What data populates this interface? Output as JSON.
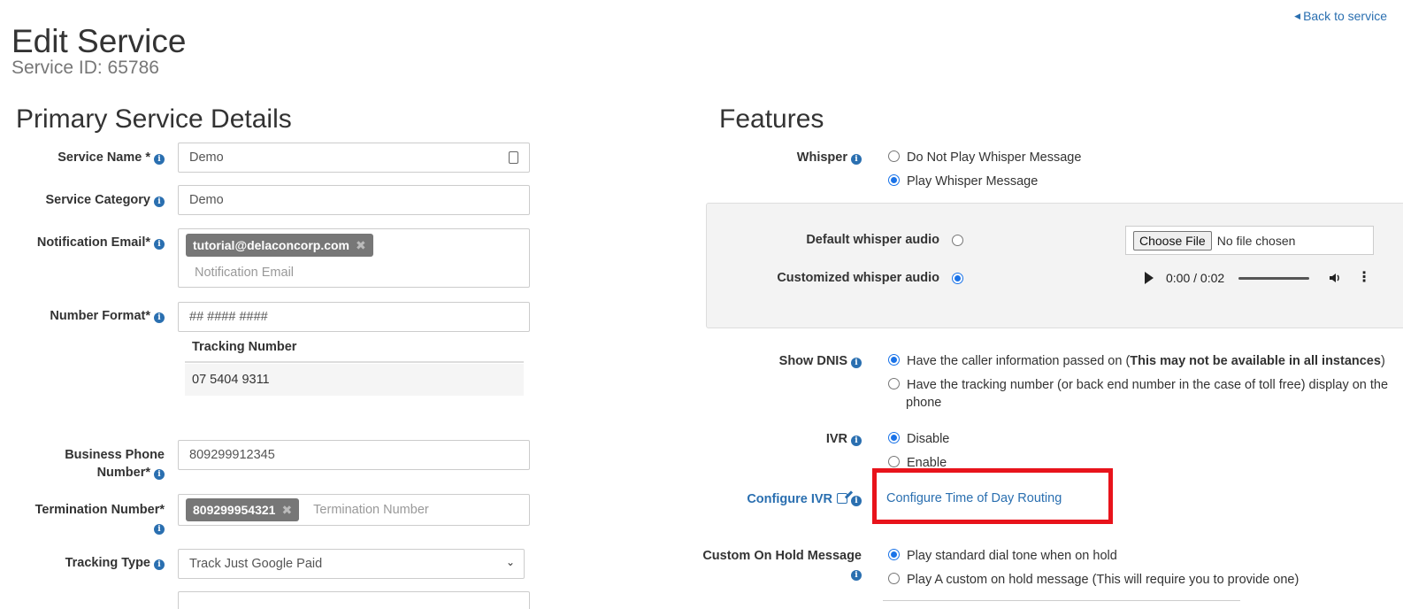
{
  "header": {
    "back_link": "Back to service",
    "title": "Edit Service",
    "subtitle": "Service ID: 65786"
  },
  "primary": {
    "section_title": "Primary Service Details",
    "service_name": {
      "label": "Service Name *",
      "value": "Demo"
    },
    "service_category": {
      "label": "Service Category",
      "value": "Demo"
    },
    "notification_email": {
      "label": "Notification Email*",
      "tag": "tutorial@delaconcorp.com",
      "placeholder": "Notification Email"
    },
    "number_format": {
      "label": "Number Format*",
      "value": "## #### ####"
    },
    "tracking_table": {
      "header": "Tracking Number",
      "rows": [
        "07 5404 9311"
      ]
    },
    "business_phone": {
      "label_line1": "Business Phone",
      "label_line2": "Number*",
      "value": "809299912345"
    },
    "termination_number": {
      "label": "Termination Number*",
      "tag": "809299954321",
      "placeholder": "Termination Number"
    },
    "tracking_type": {
      "label": "Tracking Type",
      "value": "Track Just Google Paid"
    }
  },
  "features": {
    "section_title": "Features",
    "whisper": {
      "label": "Whisper",
      "options": [
        "Do Not Play Whisper Message",
        "Play Whisper Message"
      ],
      "selected": 1
    },
    "whisper_panel": {
      "default_label": "Default whisper audio",
      "custom_label": "Customized whisper audio",
      "choose_file": "Choose File",
      "no_file": "No file chosen",
      "audio_time": "0:00 / 0:02"
    },
    "show_dnis": {
      "label": "Show DNIS",
      "option1_prefix": "Have the caller information passed on (",
      "option1_bold": "This may not be available in all instances",
      "option1_suffix": ")",
      "option2_line1": "Have the tracking number (or back end number in the case of toll free) display on the",
      "option2_line2": "phone"
    },
    "ivr": {
      "label": "IVR",
      "options": [
        "Disable",
        "Enable"
      ]
    },
    "configure_ivr": {
      "label": "Configure IVR",
      "link": "Configure Time of Day Routing"
    },
    "on_hold": {
      "label": "Custom On Hold Message",
      "options": [
        "Play standard dial tone when on hold",
        "Play A custom on hold message (This will require you to provide one)"
      ]
    }
  },
  "colors": {
    "accent": "#2a6fb0",
    "highlight": "#e8131b",
    "tag_bg": "#777777"
  }
}
